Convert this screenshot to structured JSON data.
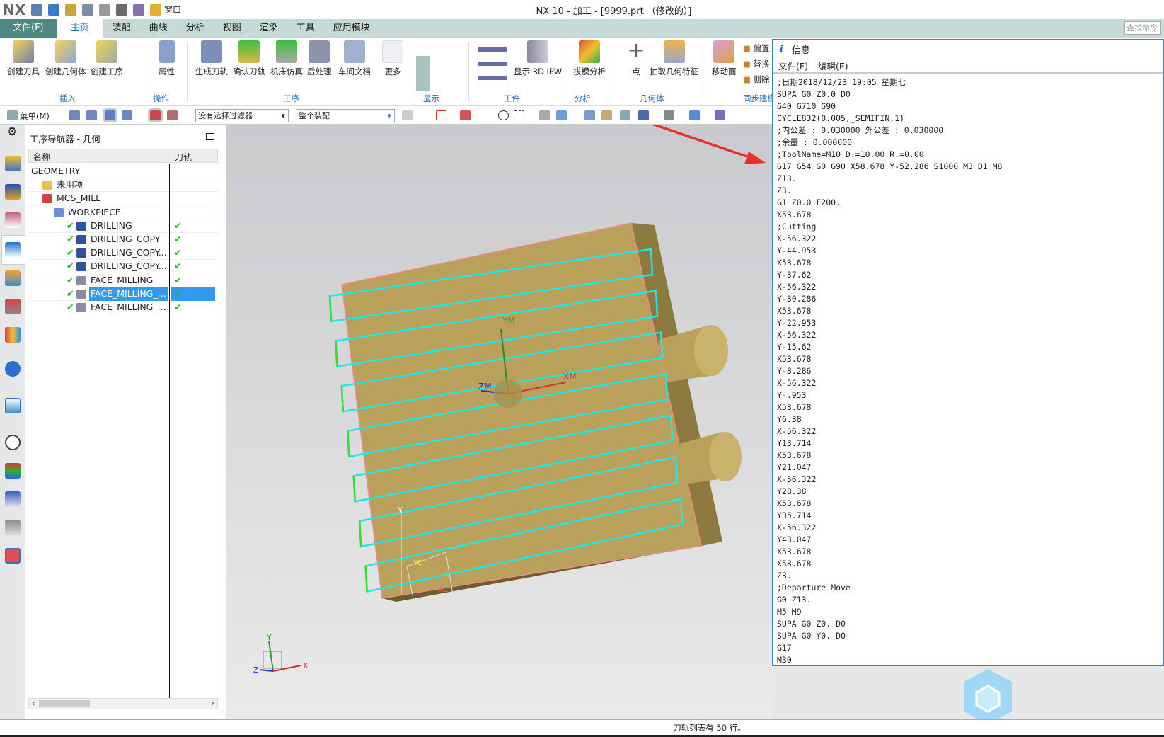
{
  "app": {
    "logo": "NX",
    "title": "NX 10 - 加工 - [9999.prt （修改的）]",
    "window_menu": "窗口"
  },
  "tabs": [
    {
      "label": "文件(F)"
    },
    {
      "label": "主页"
    },
    {
      "label": "装配"
    },
    {
      "label": "曲线"
    },
    {
      "label": "分析"
    },
    {
      "label": "视图"
    },
    {
      "label": "渲染"
    },
    {
      "label": "工具"
    },
    {
      "label": "应用模块"
    }
  ],
  "search_placeholder": "查找命令",
  "ribbon": {
    "buttons": [
      {
        "label": "创建刀具"
      },
      {
        "label": "创建几何体"
      },
      {
        "label": "创建工序"
      },
      {
        "label": "属性"
      },
      {
        "label": "生成刀轨"
      },
      {
        "label": "确认刀轨"
      },
      {
        "label": "机床仿真"
      },
      {
        "label": "后处理"
      },
      {
        "label": "车间文档"
      },
      {
        "label": "更多"
      },
      {
        "label": "显示 3D IPW"
      },
      {
        "label": "拔模分析"
      },
      {
        "label": "点"
      },
      {
        "label": "抽取几何特征"
      },
      {
        "label": "移动面"
      },
      {
        "label": "偏置"
      },
      {
        "label": "替换"
      },
      {
        "label": "删除"
      }
    ],
    "groups": [
      {
        "label": "插入"
      },
      {
        "label": "操作"
      },
      {
        "label": "工序"
      },
      {
        "label": "显示"
      },
      {
        "label": "工件"
      },
      {
        "label": "分析"
      },
      {
        "label": "几何体"
      },
      {
        "label": "同步建模"
      }
    ]
  },
  "toolbar": {
    "menu_label": "菜单(M)",
    "filter": "没有选择过滤器",
    "scope": "整个装配"
  },
  "navigator": {
    "title": "工序导航器 - 几何",
    "columns": [
      "名称",
      "刀轨"
    ],
    "rows": [
      {
        "name": "GEOMETRY",
        "indent": 0,
        "icon": "none",
        "check": false
      },
      {
        "name": "未用项",
        "indent": 1,
        "icon": "folder-icon",
        "check": false
      },
      {
        "name": "MCS_MILL",
        "indent": 1,
        "icon": "csys-icon",
        "check": false
      },
      {
        "name": "WORKPIECE",
        "indent": 2,
        "icon": "workpiece-icon",
        "check": false
      },
      {
        "name": "DRILLING",
        "indent": 3,
        "icon": "drilling-icon",
        "check": true
      },
      {
        "name": "DRILLING_COPY",
        "indent": 3,
        "icon": "drilling-icon",
        "check": true
      },
      {
        "name": "DRILLING_COPY...",
        "indent": 3,
        "icon": "drilling-icon",
        "check": true
      },
      {
        "name": "DRILLING_COPY...",
        "indent": 3,
        "icon": "drilling-icon",
        "check": true
      },
      {
        "name": "FACE_MILLING",
        "indent": 3,
        "icon": "face-milling-icon",
        "check": true
      },
      {
        "name": "FACE_MILLING_...",
        "indent": 3,
        "icon": "face-milling-icon",
        "check": true,
        "selected": true
      },
      {
        "name": "FACE_MILLING_...",
        "indent": 3,
        "icon": "face-milling-icon",
        "check": true
      }
    ]
  },
  "viewport": {
    "labels": {
      "ym": "YM",
      "xm": "XM",
      "zm": "ZM",
      "y": "Y",
      "x": "X",
      "z": "Z",
      "xc": "XC",
      "yc": "YC"
    },
    "colors": {
      "part": "#b9a15c",
      "toolpath": "#22e5e5",
      "arrow": "#e8302a"
    }
  },
  "info": {
    "title": "信息",
    "menu": [
      "文件(F)",
      "编辑(E)"
    ],
    "lines": [
      ";日期2018/12/23 19:05 星期七",
      "SUPA G0 Z0.0 D0",
      "G40 G710 G90",
      "CYCLE832(0.005,_SEMIFIN,1)",
      ";内公差 : 0.030000 外公差 : 0.030000",
      ";余量 : 0.000000",
      ";ToolName=M10 D.=10.00 R.=0.00",
      "G17 G54 G0 G90 X58.678 Y-52.286 S1000 M3 D1 M8",
      "Z13.",
      "Z3.",
      "G1 Z0.0 F200.",
      "X53.678",
      ";Cutting",
      "X-56.322",
      "Y-44.953",
      "X53.678",
      "Y-37.62",
      "X-56.322",
      "Y-30.286",
      "X53.678",
      "Y-22.953",
      "X-56.322",
      "Y-15.62",
      "X53.678",
      "Y-8.286",
      "X-56.322",
      "Y-.953",
      "X53.678",
      "Y6.38",
      "X-56.322",
      "Y13.714",
      "X53.678",
      "Y21.047",
      "X-56.322",
      "Y28.38",
      "X53.678",
      "Y35.714",
      "X-56.322",
      "Y43.047",
      "X53.678",
      "X58.678",
      "Z3.",
      ";Departure Move",
      "G0 Z13.",
      "M5 M9",
      "SUPA G0 Z0. D0",
      "SUPA G0 Y0. D0",
      "G17",
      "M30"
    ]
  },
  "status": "刀轨列表有 50 行。"
}
